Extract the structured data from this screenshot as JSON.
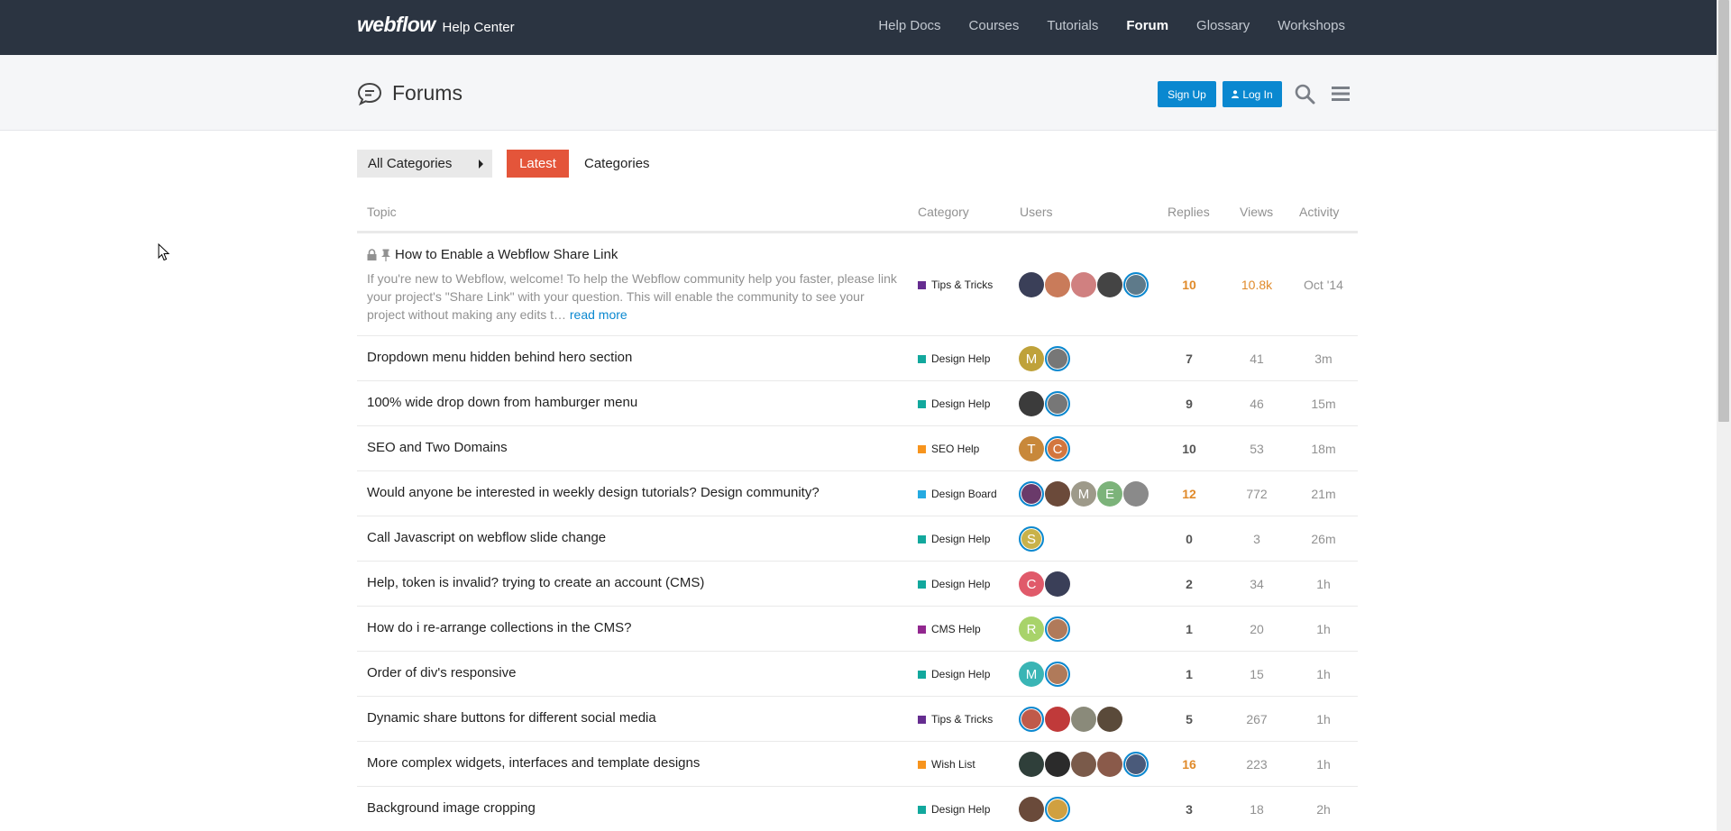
{
  "header": {
    "logo": "webflow",
    "subtitle": "Help Center",
    "nav": [
      "Help Docs",
      "Courses",
      "Tutorials",
      "Forum",
      "Glossary",
      "Workshops"
    ],
    "active_nav": "Forum"
  },
  "subheader": {
    "title": "Forums",
    "signup_label": "Sign Up",
    "login_label": "Log In"
  },
  "filters": {
    "all_categories": "All Categories",
    "latest": "Latest",
    "categories": "Categories"
  },
  "columns": {
    "topic": "Topic",
    "category": "Category",
    "users": "Users",
    "replies": "Replies",
    "views": "Views",
    "activity": "Activity"
  },
  "pinned": {
    "title": "How to Enable a Webflow Share Link",
    "excerpt": "If you're new to Webflow, welcome! To help the Webflow community help you faster, please link your project's \"Share Link\" with your question. This will enable the community to see your project without making any edits t…",
    "read_more": "read more",
    "category": "Tips & Tricks",
    "category_color": "#652d90",
    "replies": "10",
    "views": "10.8k",
    "activity": "Oct '14",
    "avatars": [
      {
        "letter": "",
        "color": "#3a3f58"
      },
      {
        "letter": "",
        "color": "#c97b5a"
      },
      {
        "letter": "",
        "color": "#d08080"
      },
      {
        "letter": "",
        "color": "#444444"
      },
      {
        "letter": "",
        "color": "#5e7a8a",
        "op": true
      }
    ]
  },
  "topics": [
    {
      "title": "Dropdown menu hidden behind hero section",
      "category": "Design Help",
      "color": "#12a89d",
      "replies": "7",
      "views": "41",
      "activity": "3m",
      "avatars": [
        {
          "letter": "M",
          "color": "#bfa23a"
        },
        {
          "letter": "",
          "color": "#777777",
          "op": true
        }
      ]
    },
    {
      "title": "100% wide drop down from hamburger menu",
      "category": "Design Help",
      "color": "#12a89d",
      "replies": "9",
      "views": "46",
      "activity": "15m",
      "avatars": [
        {
          "letter": "",
          "color": "#3b3b3b"
        },
        {
          "letter": "",
          "color": "#777777",
          "op": true
        }
      ]
    },
    {
      "title": "SEO and Two Domains",
      "category": "SEO Help",
      "color": "#f7941d",
      "replies": "10",
      "views": "53",
      "activity": "18m",
      "avatars": [
        {
          "letter": "T",
          "color": "#c8883a"
        },
        {
          "letter": "C",
          "color": "#d3763e",
          "op": true
        }
      ]
    },
    {
      "title": "Would anyone be interested in weekly design tutorials? Design community?",
      "category": "Design Board",
      "color": "#25aae1",
      "replies": "12",
      "views": "772",
      "activity": "21m",
      "hot_replies": true,
      "avatars": [
        {
          "letter": "",
          "color": "#6a3a6a",
          "op": true
        },
        {
          "letter": "",
          "color": "#6b4a3a"
        },
        {
          "letter": "M",
          "color": "#9e9a8a"
        },
        {
          "letter": "E",
          "color": "#7cb37a"
        },
        {
          "letter": "",
          "color": "#8a8a8a"
        }
      ]
    },
    {
      "title": "Call Javascript on webflow slide change",
      "category": "Design Help",
      "color": "#12a89d",
      "replies": "0",
      "views": "3",
      "activity": "26m",
      "avatars": [
        {
          "letter": "S",
          "color": "#c9b24a",
          "op": true
        }
      ]
    },
    {
      "title": "Help, token is invalid? trying to create an account (CMS)",
      "category": "Design Help",
      "color": "#12a89d",
      "replies": "2",
      "views": "34",
      "activity": "1h",
      "avatars": [
        {
          "letter": "C",
          "color": "#e05a6a"
        },
        {
          "letter": "",
          "color": "#3a3f58"
        }
      ]
    },
    {
      "title": "How do i re-arrange collections in the CMS?",
      "category": "CMS Help",
      "color": "#92278f",
      "replies": "1",
      "views": "20",
      "activity": "1h",
      "avatars": [
        {
          "letter": "R",
          "color": "#a8d36a"
        },
        {
          "letter": "",
          "color": "#b07a5a",
          "op": true
        }
      ]
    },
    {
      "title": "Order of div's responsive",
      "category": "Design Help",
      "color": "#12a89d",
      "replies": "1",
      "views": "15",
      "activity": "1h",
      "avatars": [
        {
          "letter": "M",
          "color": "#3ab5b5"
        },
        {
          "letter": "",
          "color": "#b07a5a",
          "op": true
        }
      ]
    },
    {
      "title": "Dynamic share buttons for different social media",
      "category": "Tips & Tricks",
      "color": "#652d90",
      "replies": "5",
      "views": "267",
      "activity": "1h",
      "avatars": [
        {
          "letter": "",
          "color": "#c05a4a",
          "op": true
        },
        {
          "letter": "",
          "color": "#c03a3a"
        },
        {
          "letter": "",
          "color": "#8a8a7a"
        },
        {
          "letter": "",
          "color": "#5a4a3a"
        }
      ]
    },
    {
      "title": "More complex widgets, interfaces and template designs",
      "category": "Wish List",
      "color": "#f7941d",
      "replies": "16",
      "views": "223",
      "activity": "1h",
      "hot_replies": true,
      "avatars": [
        {
          "letter": "",
          "color": "#2f3f3a"
        },
        {
          "letter": "",
          "color": "#2b2b2b"
        },
        {
          "letter": "",
          "color": "#7a5a4a"
        },
        {
          "letter": "",
          "color": "#8a5a4a"
        },
        {
          "letter": "",
          "color": "#4a5a7a",
          "op": true
        }
      ]
    },
    {
      "title": "Background image cropping",
      "category": "Design Help",
      "color": "#12a89d",
      "replies": "3",
      "views": "18",
      "activity": "2h",
      "avatars": [
        {
          "letter": "",
          "color": "#6a4a3a"
        },
        {
          "letter": "",
          "color": "#d0a040",
          "op": true
        }
      ]
    }
  ]
}
